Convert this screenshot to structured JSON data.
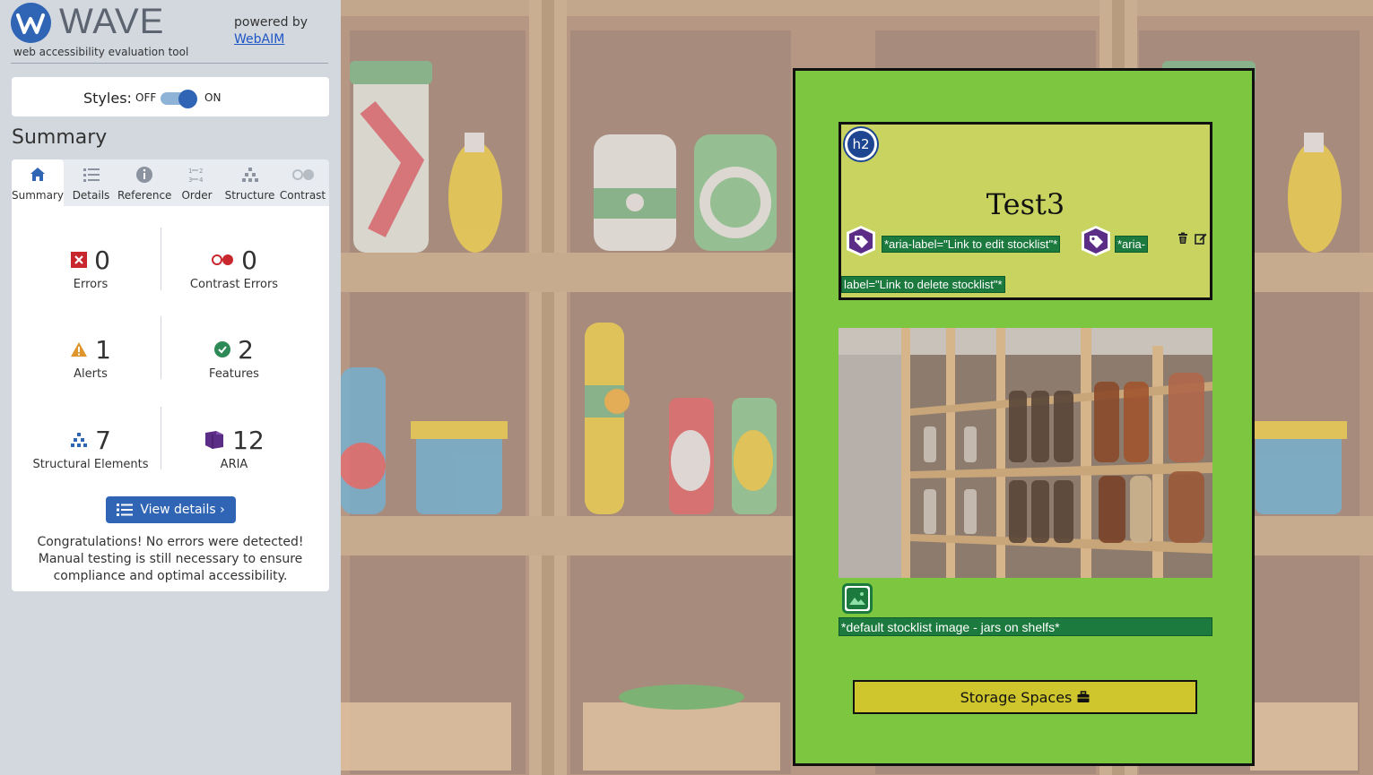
{
  "wave": {
    "title": "WAVE",
    "tagline": "web accessibility evaluation tool",
    "powered_by": "powered by",
    "webaim_link": "WebAIM",
    "styles_label": "Styles:",
    "styles_off": "OFF",
    "styles_on": "ON",
    "styles_enabled": true,
    "summary_heading": "Summary",
    "tabs": [
      {
        "label": "Summary",
        "icon": "home-icon",
        "active": true
      },
      {
        "label": "Details",
        "icon": "list-icon",
        "active": false
      },
      {
        "label": "Reference",
        "icon": "info-icon",
        "active": false
      },
      {
        "label": "Order",
        "icon": "order-icon",
        "active": false
      },
      {
        "label": "Structure",
        "icon": "structure-icon",
        "active": false
      },
      {
        "label": "Contrast",
        "icon": "contrast-icon",
        "active": false
      }
    ],
    "stats": {
      "errors": {
        "count": "0",
        "label": "Errors",
        "color": "#c8272d"
      },
      "contrast_errors": {
        "count": "0",
        "label": "Contrast Errors",
        "color": "#c8272d"
      },
      "alerts": {
        "count": "1",
        "label": "Alerts",
        "color": "#e0952b"
      },
      "features": {
        "count": "2",
        "label": "Features",
        "color": "#2e8b57"
      },
      "structural": {
        "count": "7",
        "label": "Structural Elements",
        "color": "#2f65b4"
      },
      "aria": {
        "count": "12",
        "label": "ARIA",
        "color": "#5b2d86"
      }
    },
    "view_details": "View details ›",
    "congrats": "Congratulations! No errors were detected! Manual testing is still necessary to ensure compliance and optimal accessibility."
  },
  "card": {
    "heading_badge": "h2",
    "title": "Test3",
    "aria_edit": "*aria-label=\"Link to edit stocklist\"*",
    "aria_delete_part1": "*aria-",
    "aria_delete_part2": "label=\"Link to delete stocklist\"*",
    "image_alt": "*default stocklist image - jars on shelfs*",
    "storage_button": "Storage Spaces"
  },
  "colors": {
    "wave_blue": "#2f65b4",
    "card_green": "#7dc63f",
    "header_olive": "#c8d45f",
    "button_yellow": "#cfc52c",
    "aria_green": "#1d7a3e",
    "aria_purple": "#5b2d86"
  }
}
